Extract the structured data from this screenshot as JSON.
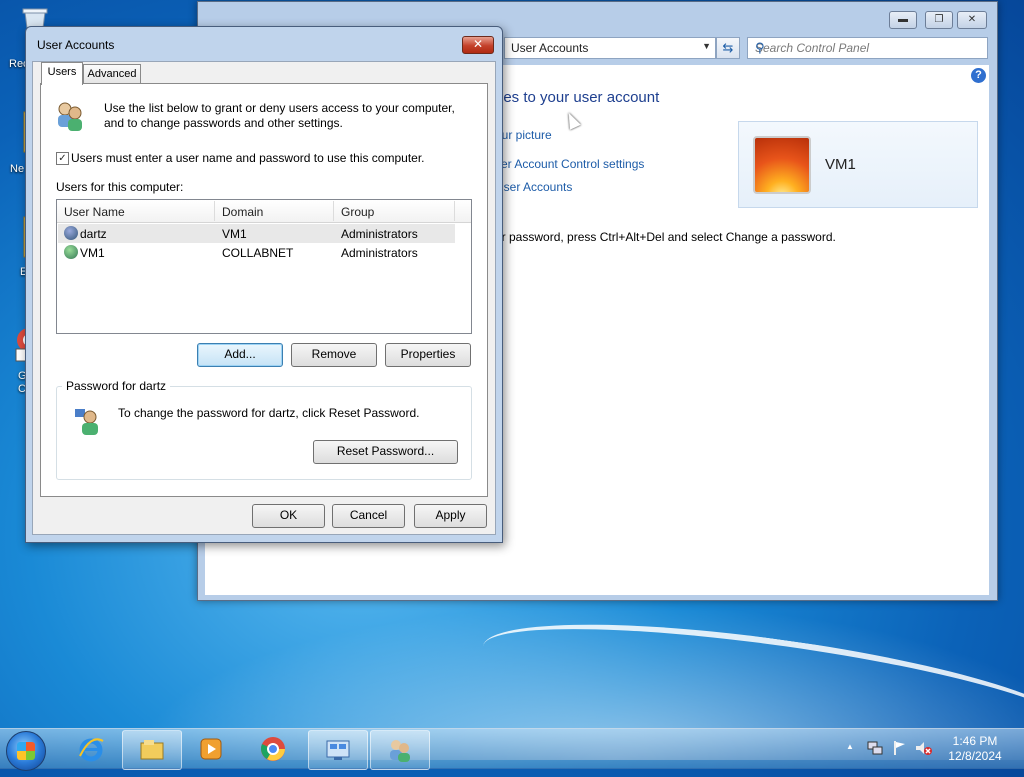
{
  "desktop": {
    "icons": [
      {
        "label": "Rec",
        "icon": "recycle-bin-icon"
      },
      {
        "label": "Ne",
        "icon": "network-icon"
      },
      {
        "label": "E",
        "icon": "folder-icon"
      },
      {
        "label": "G\nC",
        "icon": "chrome-shortcut-icon"
      }
    ]
  },
  "control_panel": {
    "window_controls": {
      "minimize": "▬",
      "maximize": "❐",
      "close": "✕"
    },
    "address": {
      "value": "User Accounts"
    },
    "search": {
      "placeholder": "Search Control Panel"
    },
    "heading": "ges to your user account",
    "links": [
      "our picture",
      "ser Account Control settings",
      "User Accounts"
    ],
    "password_text": "ur password, press Ctrl+Alt+Del and select Change a password.",
    "user_name": "VM1",
    "help": "?"
  },
  "dialog": {
    "title": "User Accounts",
    "close": "✕",
    "tabs": [
      "Users",
      "Advanced"
    ],
    "intro_line1": "Use the list below to grant or deny users access to your computer,",
    "intro_line2": "and to change passwords and other settings.",
    "checkbox_label": "Users must enter a user name and password to use this computer.",
    "checkbox_checked": true,
    "users_label": "Users for this computer:",
    "columns": [
      "User Name",
      "Domain",
      "Group"
    ],
    "users": [
      {
        "name": "dartz",
        "domain": "VM1",
        "group": "Administrators",
        "selected": true
      },
      {
        "name": "VM1",
        "domain": "COLLABNET",
        "group": "Administrators",
        "selected": false
      }
    ],
    "buttons": {
      "add": "Add...",
      "remove": "Remove",
      "properties": "Properties"
    },
    "password_group": {
      "label": "Password for dartz",
      "text": "To change the password for dartz, click Reset Password.",
      "reset": "Reset Password..."
    },
    "footer": {
      "ok": "OK",
      "cancel": "Cancel",
      "apply": "Apply"
    }
  },
  "taskbar": {
    "items": [
      "internet-explorer-icon",
      "windows-explorer-icon",
      "media-player-icon",
      "chrome-icon",
      "control-panel-icon",
      "user-accounts-icon"
    ],
    "clock_time": "1:46 PM",
    "clock_date": "12/8/2024",
    "tray_arrow": "▲"
  },
  "colors": {
    "link": "#1d5ca8",
    "heading": "#1e3f8f",
    "close_red": "#c4412b"
  }
}
